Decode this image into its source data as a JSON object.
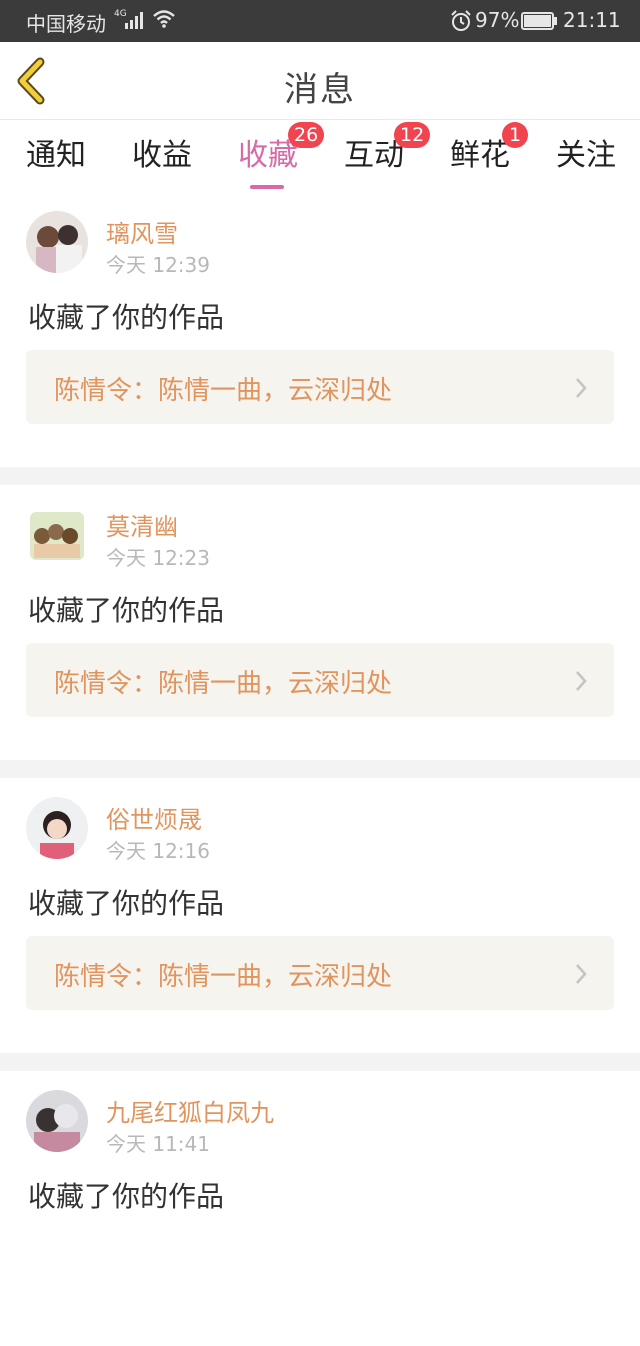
{
  "status_bar": {
    "carrier": "中国移动",
    "network": "4G",
    "battery": "97%",
    "time": "21:11"
  },
  "header": {
    "title": "消息",
    "back_icon": "chevron-left-icon"
  },
  "tabs": [
    {
      "label": "通知",
      "badge": null,
      "active": false
    },
    {
      "label": "收益",
      "badge": null,
      "active": false
    },
    {
      "label": "收藏",
      "badge": "26",
      "active": true
    },
    {
      "label": "互动",
      "badge": "12",
      "active": false
    },
    {
      "label": "鲜花",
      "badge": "1",
      "active": false
    },
    {
      "label": "关注",
      "badge": null,
      "active": false
    }
  ],
  "feed": [
    {
      "user": "璃风雪",
      "time": "今天 12:39",
      "action": "收藏了你的作品",
      "work": "陈情令：陈情一曲，云深归处"
    },
    {
      "user": "莫清幽",
      "time": "今天 12:23",
      "action": "收藏了你的作品",
      "work": "陈情令：陈情一曲，云深归处"
    },
    {
      "user": "俗世烦晟",
      "time": "今天 12:16",
      "action": "收藏了你的作品",
      "work": "陈情令：陈情一曲，云深归处"
    },
    {
      "user": "九尾红狐白凤九",
      "time": "今天 11:41",
      "action": "收藏了你的作品",
      "work": ""
    }
  ],
  "colors": {
    "accent": "#d96aa8",
    "badge": "#f0454e",
    "username": "#e1955e",
    "work_bg": "#f5f4ef"
  }
}
